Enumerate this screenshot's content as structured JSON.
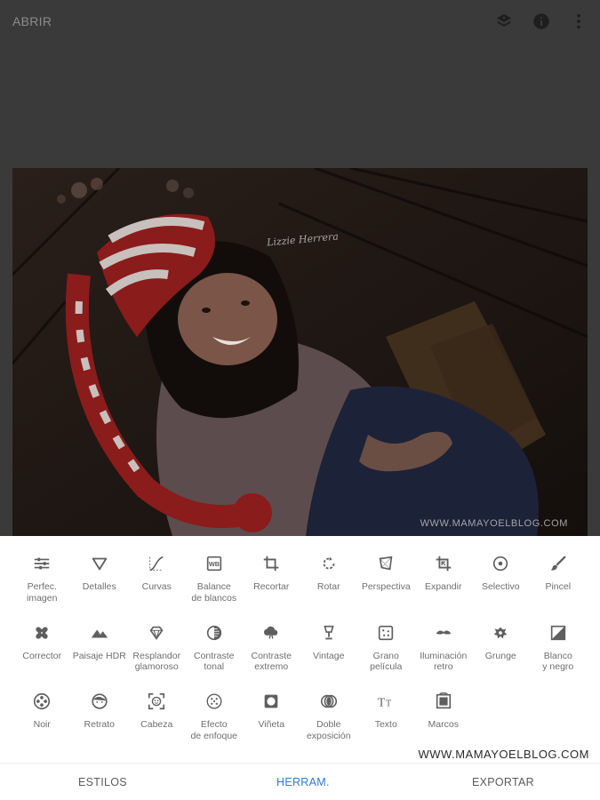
{
  "header": {
    "open_label": "ABRIR",
    "icons": [
      "layers-icon",
      "info-icon",
      "more-vert-icon"
    ]
  },
  "photo": {
    "watermark": "WWW.MAMAYOELBLOG.COM",
    "signature": "Lizzie Herrera"
  },
  "tools": [
    {
      "label": "Perfec.\nimagen",
      "icon": "tune-icon"
    },
    {
      "label": "Detalles",
      "icon": "triangle-icon"
    },
    {
      "label": "Curvas",
      "icon": "curves-icon"
    },
    {
      "label": "Balance\nde blancos",
      "icon": "white-balance-icon"
    },
    {
      "label": "Recortar",
      "icon": "crop-icon"
    },
    {
      "label": "Rotar",
      "icon": "rotate-icon"
    },
    {
      "label": "Perspectiva",
      "icon": "perspective-icon"
    },
    {
      "label": "Expandir",
      "icon": "expand-icon"
    },
    {
      "label": "Selectivo",
      "icon": "selective-icon"
    },
    {
      "label": "Pincel",
      "icon": "brush-icon"
    },
    {
      "label": "Corrector",
      "icon": "bandage-icon"
    },
    {
      "label": "Paisaje HDR",
      "icon": "mountains-icon"
    },
    {
      "label": "Resplandor\nglamoroso",
      "icon": "diamond-icon"
    },
    {
      "label": "Contraste\ntonal",
      "icon": "tonal-icon"
    },
    {
      "label": "Contraste\nextremo",
      "icon": "cloud-icon"
    },
    {
      "label": "Vintage",
      "icon": "lamp-icon"
    },
    {
      "label": "Grano\npelícula",
      "icon": "grain-icon"
    },
    {
      "label": "Iluminación\nretro",
      "icon": "mustache-icon"
    },
    {
      "label": "Grunge",
      "icon": "grunge-icon"
    },
    {
      "label": "Blanco\ny negro",
      "icon": "bw-icon"
    },
    {
      "label": "Noir",
      "icon": "film-reel-icon"
    },
    {
      "label": "Retrato",
      "icon": "face-icon"
    },
    {
      "label": "Cabeza",
      "icon": "face-scan-icon"
    },
    {
      "label": "Efecto\nde enfoque",
      "icon": "focus-icon"
    },
    {
      "label": "Viñeta",
      "icon": "vignette-icon"
    },
    {
      "label": "Doble\nexposición",
      "icon": "double-exposure-icon"
    },
    {
      "label": "Texto",
      "icon": "text-icon"
    },
    {
      "label": "Marcos",
      "icon": "frame-icon"
    }
  ],
  "footer_watermark": "WWW.MAMAYOELBLOG.COM",
  "nav": {
    "styles": "ESTILOS",
    "tools": "HERRAM.",
    "export": "EXPORTAR",
    "active": "tools"
  },
  "colors": {
    "accent": "#2c7bd6",
    "icon": "#5f5f5f",
    "dim_overlay": "#3a3a3a"
  }
}
